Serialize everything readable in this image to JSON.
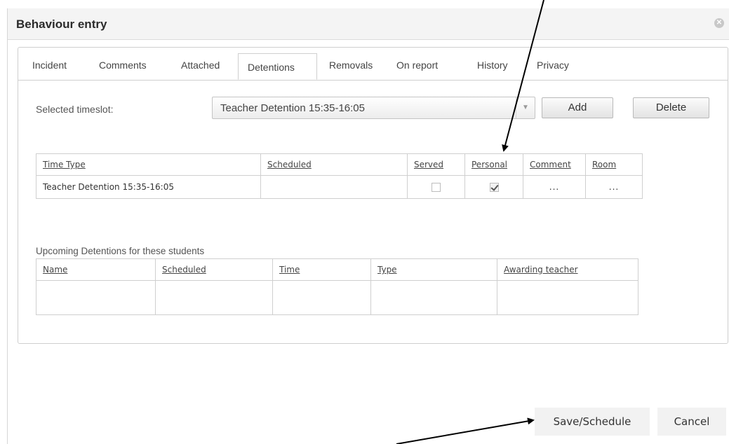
{
  "dialog": {
    "title": "Behaviour entry",
    "close_icon": "close-icon"
  },
  "tabs": [
    {
      "label": "Incident",
      "active": false
    },
    {
      "label": "Comments",
      "active": false
    },
    {
      "label": "Attached",
      "active": false
    },
    {
      "label": "Detentions",
      "active": true
    },
    {
      "label": "Removals",
      "active": false
    },
    {
      "label": "On report",
      "active": false
    },
    {
      "label": "History",
      "active": false
    },
    {
      "label": "Privacy",
      "active": false
    }
  ],
  "timeslot": {
    "label": "Selected timeslot:",
    "value": "Teacher Detention 15:35-16:05",
    "add_label": "Add",
    "delete_label": "Delete"
  },
  "detentions_table": {
    "columns": [
      "Time Type",
      "Scheduled",
      "Served",
      "Personal",
      "Comment",
      "Room"
    ],
    "rows": [
      {
        "time_type": "Teacher Detention 15:35-16:05",
        "scheduled": "",
        "served": false,
        "personal": true,
        "comment": "...",
        "room": "..."
      }
    ]
  },
  "upcoming": {
    "heading": "Upcoming Detentions for these students",
    "columns": [
      "Name",
      "Scheduled",
      "Time",
      "Type",
      "Awarding teacher"
    ]
  },
  "footer": {
    "save_label": "Save/Schedule",
    "cancel_label": "Cancel"
  },
  "colors": {
    "arrow": "#000000",
    "titlebar": "#f4f4f4",
    "border": "#cfcfcf"
  }
}
